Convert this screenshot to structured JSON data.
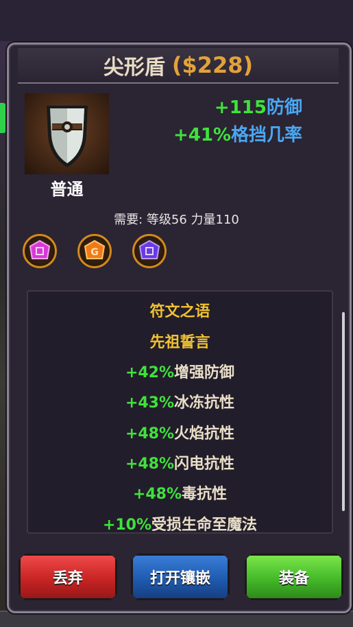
{
  "item": {
    "name": "尖形盾",
    "price": "($228)",
    "rarity": "普通",
    "icon": "shield-icon"
  },
  "stats": [
    {
      "value": "+115",
      "label": "防御"
    },
    {
      "value": "+41%",
      "label": "格挡几率"
    }
  ],
  "requirement": "需要: 等级56 力量110",
  "sockets": [
    {
      "name": "pink-rune-icon",
      "color": "#d63ad6",
      "glyph": "◈"
    },
    {
      "name": "orange-rune-icon",
      "color": "#f07a1a",
      "glyph": "G"
    },
    {
      "name": "purple-rune-icon",
      "color": "#6a3ae0",
      "glyph": "◈"
    }
  ],
  "runeword": {
    "header": "符文之语",
    "name": "先祖誓言",
    "lines": [
      {
        "value": "+42%",
        "label": "增强防御"
      },
      {
        "value": "+43%",
        "label": "冰冻抗性"
      },
      {
        "value": "+48%",
        "label": "火焰抗性"
      },
      {
        "value": "+48%",
        "label": "闪电抗性"
      },
      {
        "value": "+48%",
        "label": "毒抗性"
      },
      {
        "value": "+10%",
        "label": "受损生命至魔法"
      }
    ]
  },
  "buttons": {
    "discard": "丢弃",
    "socket": "打开镶嵌",
    "equip": "装备"
  },
  "colors": {
    "price": "#e2a23a",
    "stat_value": "#3fe23c",
    "stat_label": "#4aa7f2",
    "runeword_title": "#f1c230"
  }
}
